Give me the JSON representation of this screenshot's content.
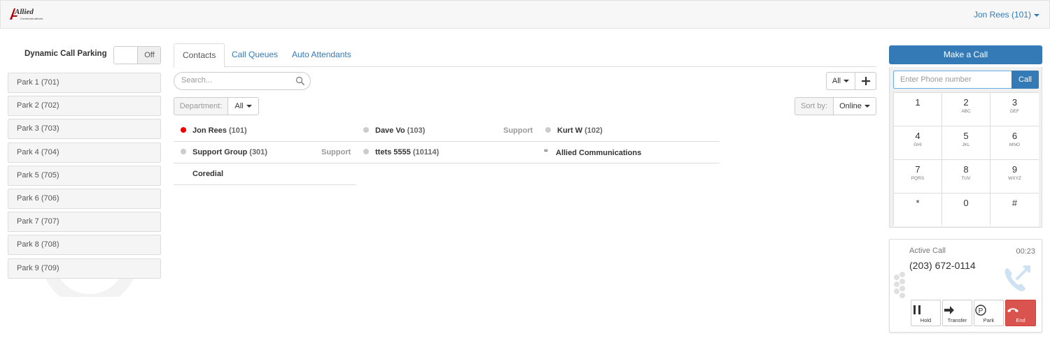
{
  "app": {
    "logo_text": "Allied",
    "logo_sub": "Communications"
  },
  "header": {
    "user_menu_label": "Jon Rees (101)"
  },
  "parking": {
    "title": "Dynamic Call Parking",
    "toggle_state": "Off",
    "parks": [
      {
        "label": "Park 1 (701)"
      },
      {
        "label": "Park 2 (702)"
      },
      {
        "label": "Park 3 (703)"
      },
      {
        "label": "Park 4 (704)"
      },
      {
        "label": "Park 5 (705)"
      },
      {
        "label": "Park 6 (706)"
      },
      {
        "label": "Park 7 (707)"
      },
      {
        "label": "Park 8 (708)"
      },
      {
        "label": "Park 9 (709)"
      }
    ]
  },
  "tabs": [
    {
      "label": "Contacts",
      "active": true
    },
    {
      "label": "Call Queues",
      "active": false
    },
    {
      "label": "Auto Attendants",
      "active": false
    }
  ],
  "search": {
    "placeholder": "Search..."
  },
  "filters": {
    "all_label": "All",
    "add_icon": "plus-icon",
    "department_label": "Department:",
    "department_value": "All",
    "sort_label": "Sort by:",
    "sort_value": "Online"
  },
  "contacts": {
    "row1": [
      {
        "name": "Jon Rees",
        "ext": "(101)",
        "dept": "",
        "status": "red"
      },
      {
        "name": "Dave Vo",
        "ext": "(103)",
        "dept": "Support",
        "status": "gray"
      },
      {
        "name": "Kurt W",
        "ext": "(102)",
        "dept": "",
        "status": "gray"
      }
    ],
    "row2": [
      {
        "name": "Support Group",
        "ext": "(301)",
        "dept": "Support",
        "status": "gray"
      },
      {
        "name": "ttets 5555",
        "ext": "(10114)",
        "dept": "",
        "status": "gray"
      },
      {
        "name": "Allied Communications",
        "ext": "",
        "dept": "",
        "status": "quote"
      }
    ],
    "row3": [
      {
        "name": "Coredial",
        "ext": "",
        "dept": "",
        "status": "none"
      }
    ]
  },
  "dialer": {
    "make_call_label": "Make a Call",
    "input_placeholder": "Enter Phone number",
    "call_label": "Call",
    "keys": [
      {
        "num": "1",
        "sub": ""
      },
      {
        "num": "2",
        "sub": "ABC"
      },
      {
        "num": "3",
        "sub": "DEF"
      },
      {
        "num": "4",
        "sub": "GHI"
      },
      {
        "num": "5",
        "sub": "JKL"
      },
      {
        "num": "6",
        "sub": "MNO"
      },
      {
        "num": "7",
        "sub": "PQRS"
      },
      {
        "num": "8",
        "sub": "TUV"
      },
      {
        "num": "9",
        "sub": "WXYZ"
      },
      {
        "num": "*",
        "sub": ""
      },
      {
        "num": "0",
        "sub": ""
      },
      {
        "num": "#",
        "sub": ""
      }
    ]
  },
  "active_call": {
    "label": "Active Call",
    "timer": "00:23",
    "number": "(203) 672-0114",
    "buttons": {
      "hold": "Hold",
      "transfer": "Transfer",
      "park": "Park",
      "end": "End"
    }
  },
  "colors": {
    "primary": "#337ab7",
    "danger": "#d9534f",
    "online_dot": "#ee0000",
    "offline_dot": "#cccccc"
  }
}
